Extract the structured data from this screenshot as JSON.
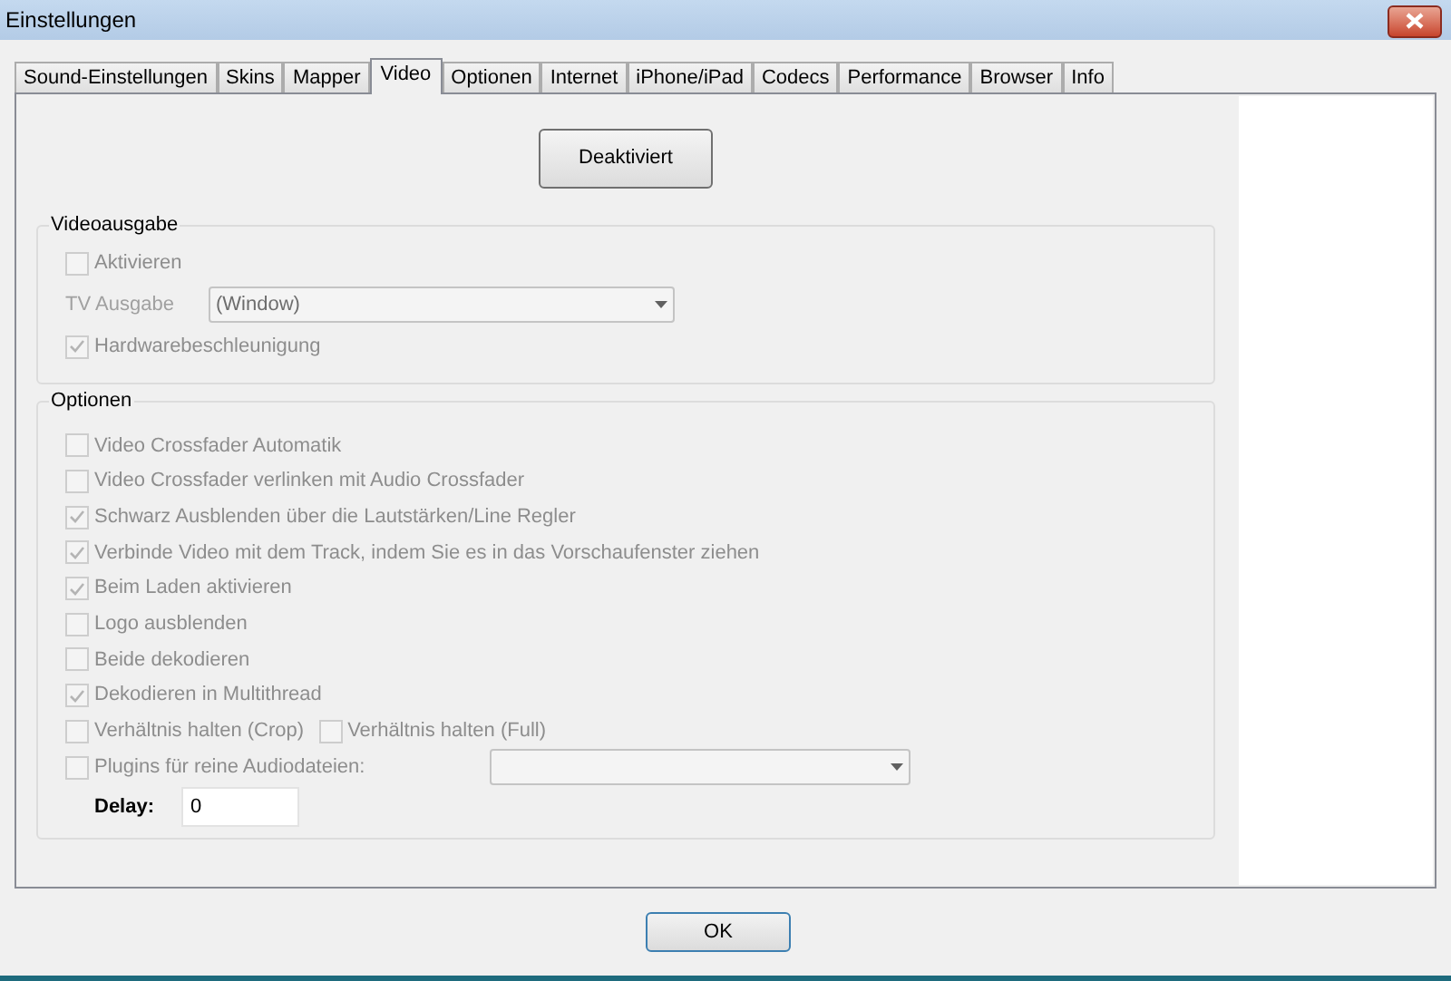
{
  "window": {
    "title": "Einstellungen"
  },
  "tabs": [
    {
      "label": "Sound-Einstellungen",
      "selected": false
    },
    {
      "label": "Skins",
      "selected": false
    },
    {
      "label": "Mapper",
      "selected": false
    },
    {
      "label": "Video",
      "selected": true
    },
    {
      "label": "Optionen",
      "selected": false
    },
    {
      "label": "Internet",
      "selected": false
    },
    {
      "label": "iPhone/iPad",
      "selected": false
    },
    {
      "label": "Codecs",
      "selected": false
    },
    {
      "label": "Performance",
      "selected": false
    },
    {
      "label": "Browser",
      "selected": false
    },
    {
      "label": "Info",
      "selected": false
    }
  ],
  "toggle_button": {
    "label": "Deaktiviert"
  },
  "video_output": {
    "title": "Videoausgabe",
    "disabled": true,
    "enable": {
      "label": "Aktivieren",
      "checked": false
    },
    "tv_output": {
      "label": "TV Ausgabe",
      "value": "(Window)"
    },
    "hw_accel": {
      "label": "Hardwarebeschleunigung",
      "checked": true
    }
  },
  "options": {
    "title": "Optionen",
    "disabled": true,
    "items": [
      {
        "kind": "checkbox",
        "label": "Video Crossfader Automatik",
        "checked": false
      },
      {
        "kind": "checkbox",
        "label": "Video Crossfader verlinken mit Audio Crossfader",
        "checked": false
      },
      {
        "kind": "checkbox",
        "label": "Schwarz Ausblenden über die Lautstärken/Line Regler",
        "checked": true
      },
      {
        "kind": "checkbox",
        "label": "Verbinde Video mit dem Track, indem Sie es in das Vorschaufenster ziehen",
        "checked": true
      },
      {
        "kind": "checkbox",
        "label": "Beim Laden aktivieren",
        "checked": true
      },
      {
        "kind": "checkbox",
        "label": "Logo ausblenden",
        "checked": false
      },
      {
        "kind": "checkbox",
        "label": "Beide dekodieren",
        "checked": false
      },
      {
        "kind": "checkbox",
        "label": "Dekodieren in Multithread",
        "checked": true
      },
      {
        "kind": "pair",
        "items": [
          {
            "label": "Verhältnis halten (Crop)",
            "checked": false
          },
          {
            "label": "Verhältnis halten (Full)",
            "checked": false
          }
        ]
      },
      {
        "kind": "dropdown",
        "label": "Plugins für reine Audiodateien:",
        "checked": false
      }
    ],
    "delay": {
      "label": "Delay:",
      "value": "0"
    }
  },
  "buttons": [
    {
      "label": "OK"
    }
  ]
}
